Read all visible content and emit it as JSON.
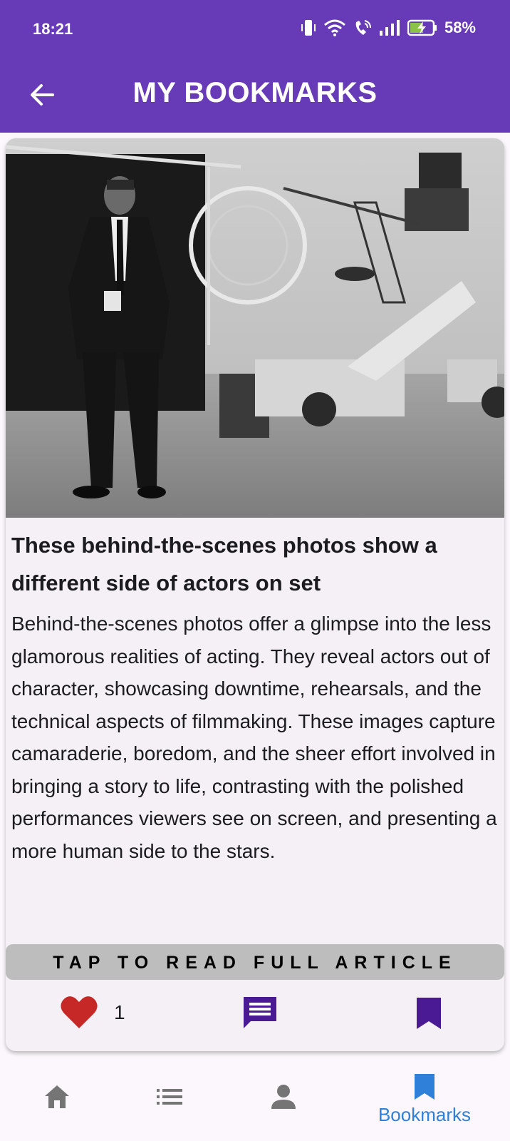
{
  "status_bar": {
    "time": "18:21",
    "battery_percent": "58%",
    "icons": [
      "vibrate-icon",
      "wifi-icon",
      "wifi-call-icon",
      "signal-icon",
      "battery-charging-icon"
    ]
  },
  "app_bar": {
    "title": "MY BOOKMARKS",
    "back_icon": "arrow-back-icon"
  },
  "article": {
    "image_description_icon": "article-photo",
    "headline": "These behind-the-scenes photos show a different side of actors on set",
    "summary": "Behind-the-scenes photos offer a glimpse into the less glamorous realities of acting. They reveal actors out of character, showcasing downtime, rehearsals, and the technical aspects of filmmaking. These images capture camaraderie, boredom, and the sheer effort involved in bringing a story to life, contrasting with the polished performances viewers see on screen, and presenting a more human side to the stars.",
    "read_more_label": "TAP TO READ FULL ARTICLE",
    "like_count": "1",
    "colors": {
      "heart": "#c62828",
      "accent": "#4a1a94"
    }
  },
  "bottom_nav": {
    "items": [
      {
        "icon": "home-icon",
        "label": ""
      },
      {
        "icon": "list-icon",
        "label": ""
      },
      {
        "icon": "person-icon",
        "label": ""
      },
      {
        "icon": "bookmark-icon",
        "label": "Bookmarks"
      }
    ],
    "active_color": "#2f80d8",
    "inactive_color": "#757575"
  },
  "colors": {
    "primary": "#673ab7",
    "background": "#fbf7fc",
    "card": "#f4f0f5"
  }
}
